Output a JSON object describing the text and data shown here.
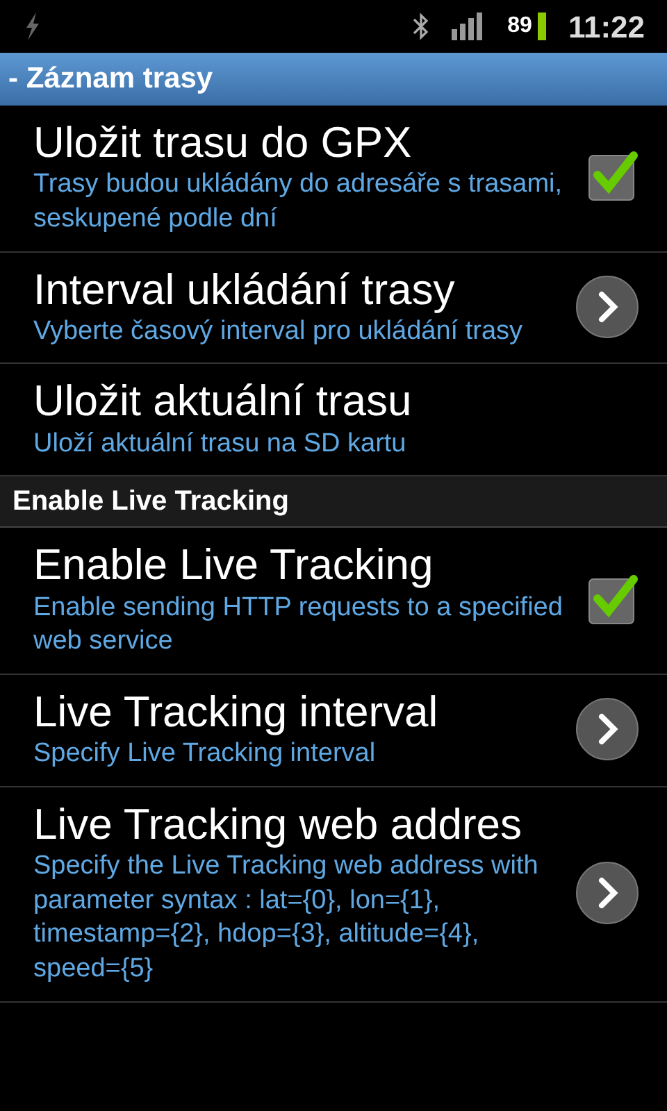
{
  "status_bar": {
    "battery": "89",
    "time": "11:22"
  },
  "title_bar": {
    "title": "- Záznam trasy"
  },
  "sections": [
    {
      "items": [
        {
          "kind": "checkbox",
          "title": "Uložit trasu do GPX",
          "summary": "Trasy budou ukládány do adresáře s trasami, seskupené podle dní",
          "checked": true
        },
        {
          "kind": "arrow",
          "title": "Interval ukládání trasy",
          "summary": "Vyberte časový interval pro ukládání trasy"
        },
        {
          "kind": "plain",
          "title": "Uložit aktuální trasu",
          "summary": "Uloží aktuální trasu na SD kartu"
        }
      ]
    },
    {
      "header": "Enable Live Tracking",
      "items": [
        {
          "kind": "checkbox",
          "title": "Enable Live Tracking",
          "summary": "Enable sending HTTP requests to a specified web service",
          "checked": true
        },
        {
          "kind": "arrow",
          "title": "Live Tracking interval",
          "summary": "Specify Live Tracking interval"
        },
        {
          "kind": "arrow",
          "title": "Live Tracking web addres",
          "summary": "Specify the Live Tracking web address with parameter syntax : lat={0}, lon={1}, timestamp={2}, hdop={3}, altitude={4}, speed={5}"
        }
      ]
    }
  ]
}
